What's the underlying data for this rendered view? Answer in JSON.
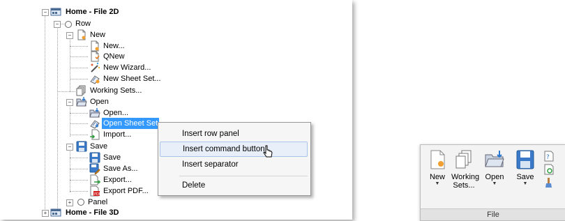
{
  "tree": {
    "root1": "Home - File 2D",
    "row": "Row",
    "new": "New",
    "new_dots": "New...",
    "qnew": "QNew",
    "new_wizard": "New Wizard...",
    "new_sheet_set": "New Sheet Set...",
    "working_sets": "Working Sets...",
    "open": "Open",
    "open_dots": "Open...",
    "open_sheet_set": "Open Sheet Set",
    "import": "Import...",
    "save": "Save",
    "save_item": "Save",
    "save_as": "Save As...",
    "export": "Export...",
    "export_pdf": "Export PDF...",
    "panel": "Panel",
    "root2": "Home - File 3D"
  },
  "context_menu": {
    "insert_row_panel": "Insert row panel",
    "insert_command_button": "Insert command button",
    "insert_separator": "Insert separator",
    "delete": "Delete"
  },
  "ribbon": {
    "new": "New",
    "working_sets_1": "Working",
    "working_sets_2": "Sets...",
    "open": "Open",
    "save": "Save",
    "panel_title": "File"
  },
  "colors": {
    "selection": "#3399ff",
    "menu_hover": "#e8eff8"
  }
}
